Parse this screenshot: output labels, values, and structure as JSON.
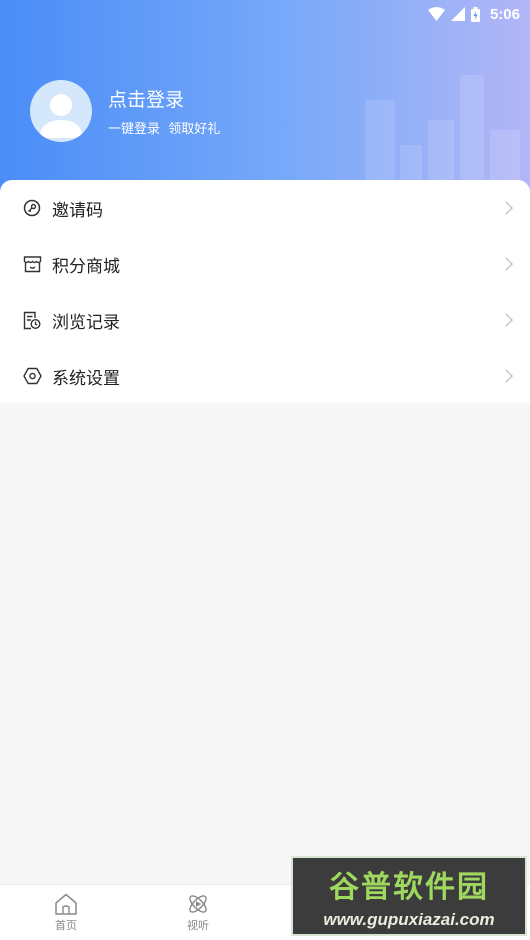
{
  "status_bar": {
    "time": "5:06"
  },
  "profile": {
    "title": "点击登录",
    "subtitle": "一键登录  领取好礼"
  },
  "menu": {
    "items": [
      {
        "label": "邀请码",
        "icon": "key-icon"
      },
      {
        "label": "积分商城",
        "icon": "store-icon"
      },
      {
        "label": "浏览记录",
        "icon": "history-icon"
      },
      {
        "label": "系统设置",
        "icon": "settings-icon"
      }
    ]
  },
  "tabbar": {
    "tabs": [
      {
        "label": "首页",
        "icon": "home-icon"
      },
      {
        "label": "视听",
        "icon": "media-icon"
      }
    ]
  },
  "watermark": {
    "title": "谷普软件园",
    "url": "www.gupuxiazai.com"
  },
  "colors": {
    "header_start": "#4a8df8",
    "header_end": "#b2b6f6",
    "background": "#f7f7f8"
  }
}
